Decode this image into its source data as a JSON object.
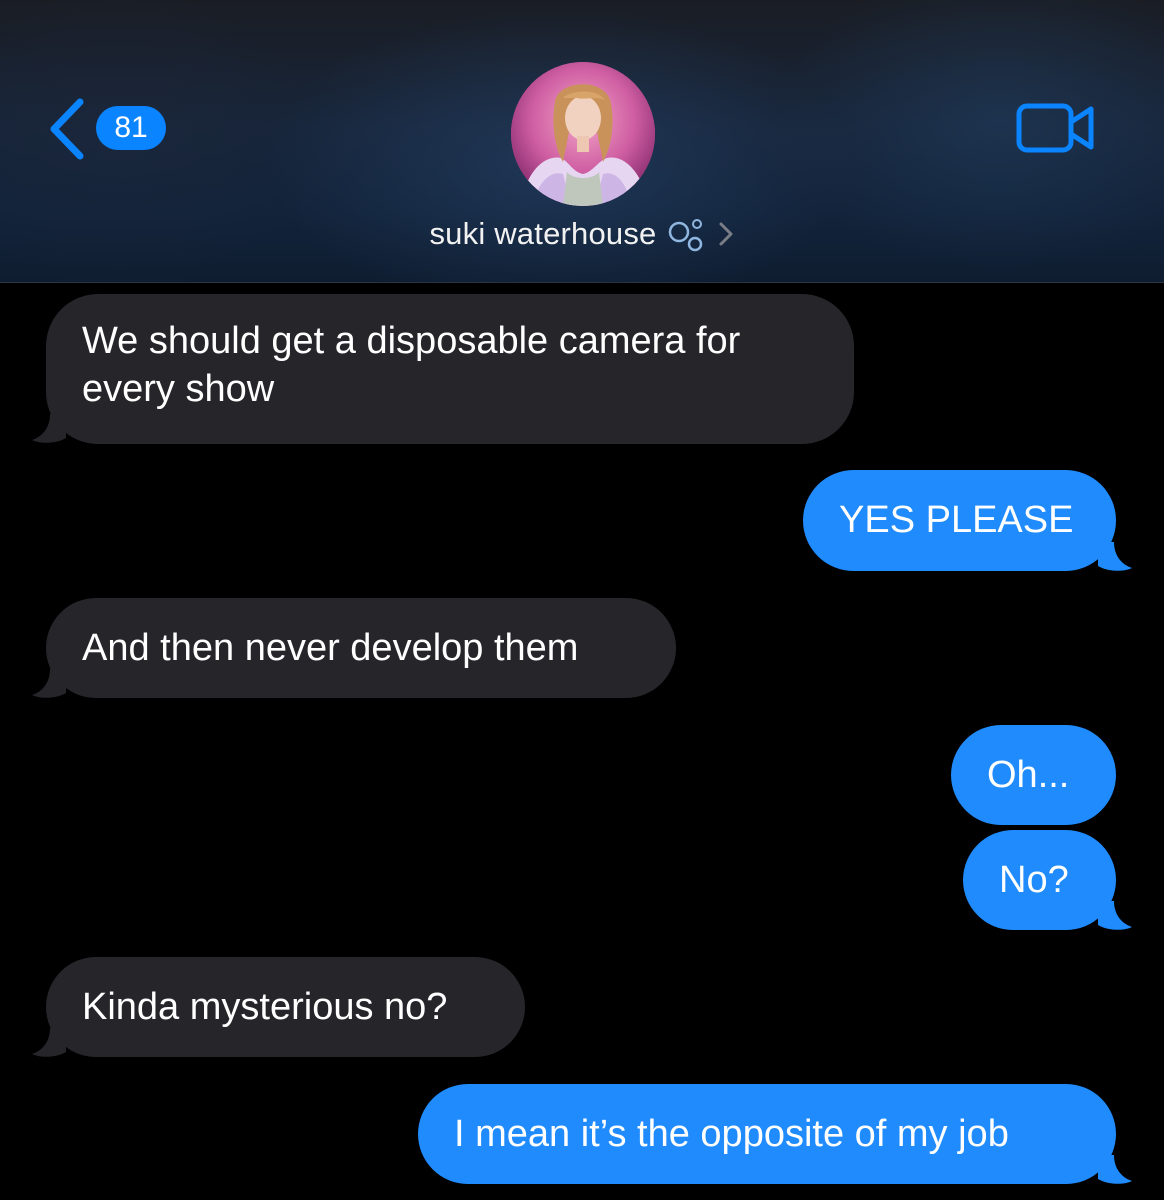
{
  "header": {
    "back_count": "81",
    "contact_name": "suki waterhouse",
    "icons": {
      "back": "chevron-left-icon",
      "video": "video-camera-icon",
      "bubbles": "bubbles-emoji-icon",
      "disclosure": "chevron-right-icon"
    }
  },
  "messages": [
    {
      "direction": "incoming",
      "text_line1": "We should get a disposable camera for",
      "text_line2": "every show"
    },
    {
      "direction": "outgoing",
      "text": "YES PLEASE"
    },
    {
      "direction": "incoming",
      "text": "And then never develop them"
    },
    {
      "direction": "outgoing",
      "text": "Oh..."
    },
    {
      "direction": "outgoing",
      "text": "No?"
    },
    {
      "direction": "incoming",
      "text": "Kinda mysterious no?"
    },
    {
      "direction": "outgoing",
      "text": "I mean it’s the opposite of my job"
    }
  ],
  "colors": {
    "incoming_bubble": "#26252a",
    "outgoing_bubble": "#1f8bfd",
    "accent": "#0a84ff",
    "background": "#000000"
  }
}
